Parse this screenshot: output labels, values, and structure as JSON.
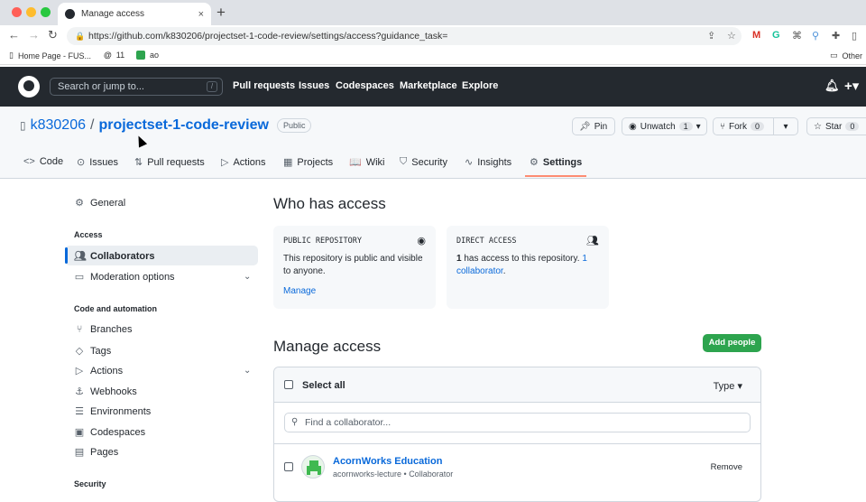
{
  "browser": {
    "tab_title": "Manage access",
    "tab_close": "×",
    "new_tab": "+",
    "url": "https://github.com/k830206/projectset-1-code-review/settings/access?guidance_task=",
    "bookmarks": [
      {
        "label": "Home Page - FUS..."
      },
      {
        "label": "11"
      },
      {
        "label": "ao"
      }
    ],
    "other_bookmarks": "Other"
  },
  "github": {
    "search_placeholder": "Search or jump to...",
    "search_shortcut": "/",
    "nav": [
      "Pull requests",
      "Issues",
      "Codespaces",
      "Marketplace",
      "Explore"
    ]
  },
  "repo": {
    "owner": "k830206",
    "separator": "/",
    "name": "projectset-1-code-review",
    "visibility": "Public",
    "pin_label": "Pin",
    "unwatch_label": "Unwatch",
    "unwatch_count": "1",
    "fork_label": "Fork",
    "fork_count": "0",
    "star_label": "Star",
    "star_count": "0",
    "tabs": [
      {
        "label": "Code",
        "icon": "<>"
      },
      {
        "label": "Issues",
        "icon": "⊙"
      },
      {
        "label": "Pull requests",
        "icon": "⇅"
      },
      {
        "label": "Actions",
        "icon": "▷"
      },
      {
        "label": "Projects",
        "icon": "▦"
      },
      {
        "label": "Wiki",
        "icon": "📖"
      },
      {
        "label": "Security",
        "icon": "⛉"
      },
      {
        "label": "Insights",
        "icon": "∿"
      },
      {
        "label": "Settings",
        "icon": "⚙"
      }
    ]
  },
  "sidebar": {
    "general": "General",
    "access_heading": "Access",
    "collaborators": "Collaborators",
    "moderation": "Moderation options",
    "code_heading": "Code and automation",
    "branches": "Branches",
    "tags": "Tags",
    "actions": "Actions",
    "webhooks": "Webhooks",
    "environments": "Environments",
    "codespaces": "Codespaces",
    "pages": "Pages",
    "security_heading": "Security"
  },
  "who_has_access": {
    "title": "Who has access",
    "public_card": {
      "heading": "PUBLIC REPOSITORY",
      "body": "This repository is public and visible to anyone.",
      "link": "Manage"
    },
    "direct_card": {
      "heading": "DIRECT ACCESS",
      "count": "1",
      "body": " has access to this repository. ",
      "link": "1 collaborator",
      "end": "."
    }
  },
  "manage_access": {
    "title": "Manage access",
    "add_button": "Add people",
    "select_all": "Select all",
    "type_filter": "Type ▾",
    "find_placeholder": "Find a collaborator...",
    "members": [
      {
        "name": "AcornWorks Education",
        "login": "acornworks-lecture",
        "role": "Collaborator",
        "action": "Remove"
      }
    ]
  },
  "colors": {
    "header_bg": "#24292f",
    "link": "#0969da",
    "primary_button": "#2da44e",
    "selected_tab_underline": "#fd8c73"
  }
}
